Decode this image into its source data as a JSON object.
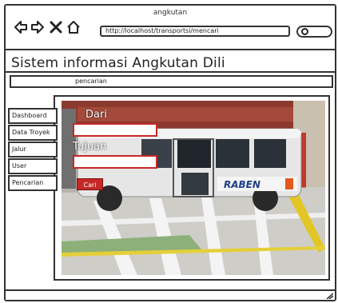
{
  "window": {
    "title": "angkutan"
  },
  "browser": {
    "url": "http://localhost/transportsi/mencari",
    "back_icon": "back-arrow-icon",
    "forward_icon": "forward-arrow-icon",
    "close_icon": "close-x-icon",
    "home_icon": "home-icon"
  },
  "app": {
    "title": "Sistem informasi Angkutan Dili"
  },
  "breadcrumb": {
    "label": "pencarian"
  },
  "sidebar": {
    "items": [
      {
        "label": "Dashboard"
      },
      {
        "label": "Data Troyek"
      },
      {
        "label": "Jalur"
      },
      {
        "label": "User"
      },
      {
        "label": "Pencarian"
      }
    ]
  },
  "form": {
    "dari_label": "Dari",
    "dari_value": "",
    "tujuan_label": "Tujuan",
    "tujuan_value": "",
    "submit_label": "Cari"
  },
  "photo": {
    "van_text": "RABEN"
  },
  "colors": {
    "accent": "#c62828",
    "frame": "#333333"
  }
}
